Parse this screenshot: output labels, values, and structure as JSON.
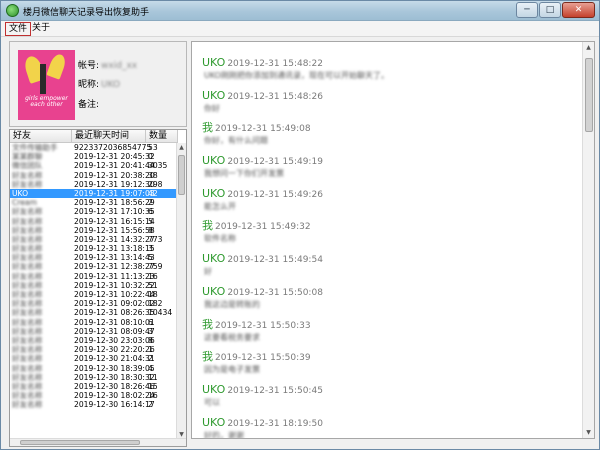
{
  "window": {
    "title": "楼月微信聊天记录导出恢复助手",
    "min_label": "─",
    "max_label": "□",
    "close_label": "✕"
  },
  "menu": {
    "file": "文件",
    "about": "关于"
  },
  "profile": {
    "avatar_caption": "girls empower each other",
    "account_label": "帐号:",
    "account_value": "wxid_xx",
    "nickname_label": "昵称:",
    "nickname_value": "UKO",
    "remark_label": "备注:",
    "remark_value": ""
  },
  "friend_list": {
    "headers": {
      "name": "好友",
      "time": "最近聊天时间",
      "count": "数量"
    },
    "rows": [
      {
        "name": "文件传输助手",
        "time": "9223372036854775",
        "count": "53"
      },
      {
        "name": "某某群聊",
        "time": "2019-12-31 20:45:32",
        "count": "0"
      },
      {
        "name": "微信团队",
        "time": "2019-12-31 20:41:44",
        "count": "3035"
      },
      {
        "name": "好友名称",
        "time": "2019-12-31 20:38:20",
        "count": "38"
      },
      {
        "name": "好友名称",
        "time": "2019-12-31 19:12:30",
        "count": "298"
      },
      {
        "name": "UKO",
        "time": "2019-12-31 19:07:03",
        "count": "42",
        "selected": true
      },
      {
        "name": "Cream",
        "time": "2019-12-31 18:56:29",
        "count": "2"
      },
      {
        "name": "好友名称",
        "time": "2019-12-31 17:10:35",
        "count": "6"
      },
      {
        "name": "好友名称",
        "time": "2019-12-31 16:15:14",
        "count": "5"
      },
      {
        "name": "好友名称",
        "time": "2019-12-31 15:56:58",
        "count": "8"
      },
      {
        "name": "好友名称",
        "time": "2019-12-31 14:32:27",
        "count": "773"
      },
      {
        "name": "好友名称",
        "time": "2019-12-31 13:18:15",
        "count": "3"
      },
      {
        "name": "好友名称",
        "time": "2019-12-31 13:14:43",
        "count": "5"
      },
      {
        "name": "好友名称",
        "time": "2019-12-31 12:38:27",
        "count": "759"
      },
      {
        "name": "好友名称",
        "time": "2019-12-31 11:13:23",
        "count": "16"
      },
      {
        "name": "好友名称",
        "time": "2019-12-31 10:32:22",
        "count": "51"
      },
      {
        "name": "好友名称",
        "time": "2019-12-31 10:22:44",
        "count": "18"
      },
      {
        "name": "好友名称",
        "time": "2019-12-31 09:02:02",
        "count": "182"
      },
      {
        "name": "好友名称",
        "time": "2019-12-31 08:26:35",
        "count": "10434"
      },
      {
        "name": "好友名称",
        "time": "2019-12-31 08:10:01",
        "count": "6"
      },
      {
        "name": "好友名称",
        "time": "2019-12-31 08:09:47",
        "count": "3"
      },
      {
        "name": "好友名称",
        "time": "2019-12-30 23:03:06",
        "count": "8"
      },
      {
        "name": "好友名称",
        "time": "2019-12-30 22:20:26",
        "count": "1"
      },
      {
        "name": "好友名称",
        "time": "2019-12-30 21:04:31",
        "count": "2"
      },
      {
        "name": "好友名称",
        "time": "2019-12-30 18:39:05",
        "count": "4"
      },
      {
        "name": "好友名称",
        "time": "2019-12-30 18:30:32",
        "count": "11"
      },
      {
        "name": "好友名称",
        "time": "2019-12-30 18:26:46",
        "count": "15"
      },
      {
        "name": "好友名称",
        "time": "2019-12-30 18:02:24",
        "count": "16"
      },
      {
        "name": "好友名称",
        "time": "2019-12-30 16:14:17",
        "count": "2"
      }
    ]
  },
  "chat": {
    "messages": [
      {
        "sender": "UKO",
        "time": "2019-12-31 15:48:22",
        "text": "UKO刚刚把你添加到通讯录，现在可以开始聊天了。",
        "self": false
      },
      {
        "sender": "UKO",
        "time": "2019-12-31 15:48:26",
        "text": "你好",
        "self": false
      },
      {
        "sender": "我",
        "time": "2019-12-31 15:49:08",
        "text": "你好，有什么问题",
        "self": true
      },
      {
        "sender": "UKO",
        "time": "2019-12-31 15:49:19",
        "text": "我想问一下你们开发票",
        "self": false
      },
      {
        "sender": "UKO",
        "time": "2019-12-31 15:49:26",
        "text": "能怎么开",
        "self": false
      },
      {
        "sender": "我",
        "time": "2019-12-31 15:49:32",
        "text": "软件名称",
        "self": true
      },
      {
        "sender": "UKO",
        "time": "2019-12-31 15:49:54",
        "text": "好",
        "self": false
      },
      {
        "sender": "UKO",
        "time": "2019-12-31 15:50:08",
        "text": "我这边是转账的",
        "self": false
      },
      {
        "sender": "我",
        "time": "2019-12-31 15:50:33",
        "text": "这要看税务要求",
        "self": true
      },
      {
        "sender": "我",
        "time": "2019-12-31 15:50:39",
        "text": "因为是电子发票",
        "self": true
      },
      {
        "sender": "UKO",
        "time": "2019-12-31 15:50:45",
        "text": "可以",
        "self": false
      },
      {
        "sender": "UKO",
        "time": "2019-12-31 18:19:50",
        "text": "好的，谢谢",
        "self": false
      }
    ]
  },
  "colors": {
    "sender": "#2f9a2f",
    "selection": "#3399ff",
    "menu_highlight": "#c03030"
  }
}
